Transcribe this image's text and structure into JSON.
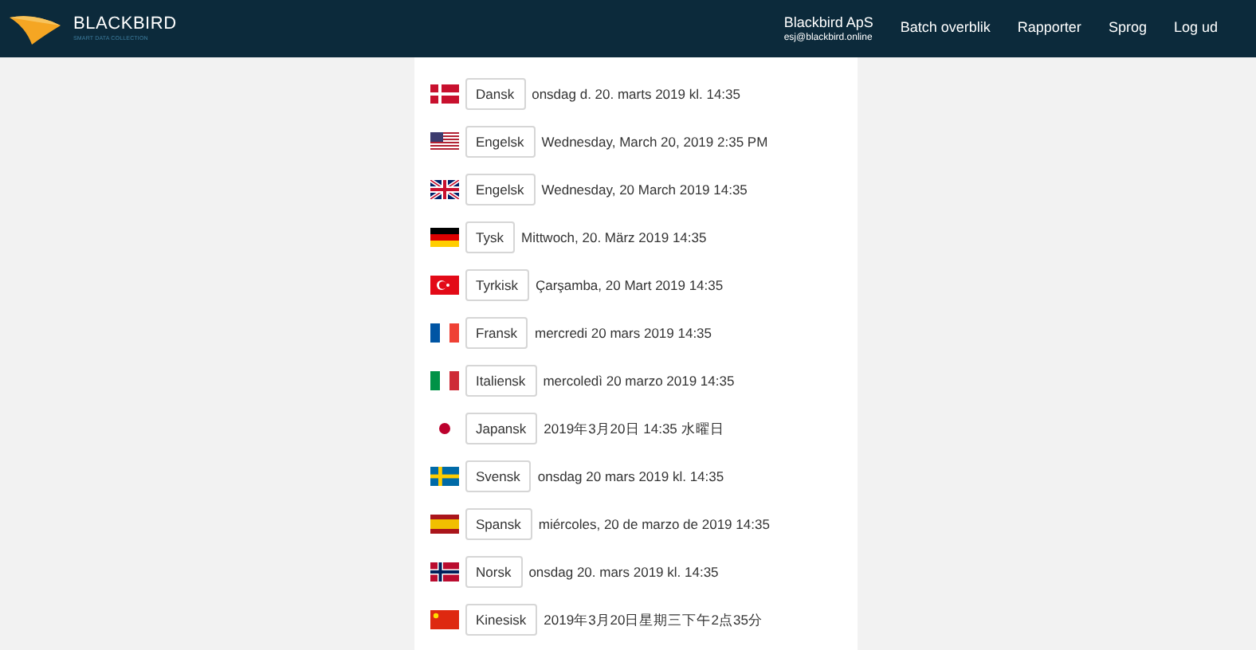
{
  "header": {
    "brand": "BLACKBIRD",
    "tagline": "SMART DATA COLLECTION",
    "account": {
      "name": "Blackbird ApS",
      "email": "esj@blackbird.online"
    },
    "nav": [
      "Batch overblik",
      "Rapporter",
      "Sprog",
      "Log ud"
    ]
  },
  "languages": [
    {
      "kind": "dk",
      "label": "Dansk",
      "sample": "onsdag d. 20. marts 2019 kl. 14:35"
    },
    {
      "kind": "us",
      "label": "Engelsk",
      "sample": "Wednesday, March 20, 2019 2:35 PM"
    },
    {
      "kind": "gb",
      "label": "Engelsk",
      "sample": "Wednesday, 20 March 2019 14:35"
    },
    {
      "kind": "de",
      "label": "Tysk",
      "sample": "Mittwoch, 20. März 2019 14:35"
    },
    {
      "kind": "tr",
      "label": "Tyrkisk",
      "sample": "Çarşamba, 20 Mart 2019 14:35"
    },
    {
      "kind": "fr",
      "label": "Fransk",
      "sample": "mercredi 20 mars 2019 14:35"
    },
    {
      "kind": "it",
      "label": "Italiensk",
      "sample": "mercoledì 20 marzo 2019 14:35"
    },
    {
      "kind": "jp",
      "label": "Japansk",
      "sample": "2019年3月20日 14:35 水曜日"
    },
    {
      "kind": "se",
      "label": "Svensk",
      "sample": "onsdag 20 mars 2019 kl. 14:35"
    },
    {
      "kind": "es",
      "label": "Spansk",
      "sample": "miércoles, 20 de marzo de 2019 14:35"
    },
    {
      "kind": "no",
      "label": "Norsk",
      "sample": "onsdag 20. mars 2019 kl. 14:35"
    },
    {
      "kind": "cn",
      "label": "Kinesisk",
      "sample": "2019年3月20日星期三下午2点35分"
    }
  ]
}
